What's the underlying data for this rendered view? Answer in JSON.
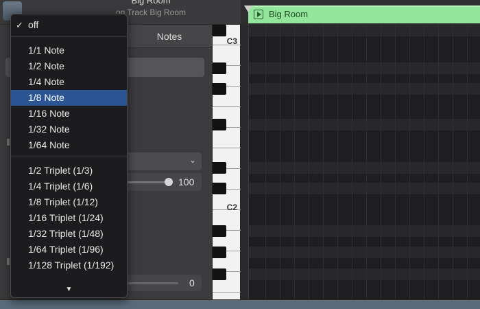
{
  "header": {
    "title": "Big Room",
    "subtitle": "on Track Big Room"
  },
  "region": {
    "name": "Big Room",
    "color": "#93e59b"
  },
  "inspector": {
    "notes_tab": "Notes",
    "slider_value": "100",
    "slider2_value": "0"
  },
  "piano": {
    "labels": [
      "C3",
      "C2"
    ]
  },
  "menu": {
    "checkmark": "✓",
    "items": [
      {
        "label": "off",
        "checked": true
      },
      {
        "label": "1/1 Note"
      },
      {
        "label": "1/2 Note"
      },
      {
        "label": "1/4 Note"
      },
      {
        "label": "1/8 Note",
        "selected": true
      },
      {
        "label": "1/16 Note"
      },
      {
        "label": "1/32 Note"
      },
      {
        "label": "1/64 Note"
      },
      {
        "label": "1/2 Triplet (1/3)"
      },
      {
        "label": "1/4 Triplet (1/6)"
      },
      {
        "label": "1/8 Triplet (1/12)"
      },
      {
        "label": "1/16 Triplet (1/24)"
      },
      {
        "label": "1/32 Triplet (1/48)"
      },
      {
        "label": "1/64 Triplet (1/96)"
      },
      {
        "label": "1/128 Triplet (1/192)"
      }
    ],
    "scroll_arrow": "▼"
  },
  "colors": {
    "selection": "#2b5693",
    "region": "#93e59b"
  }
}
